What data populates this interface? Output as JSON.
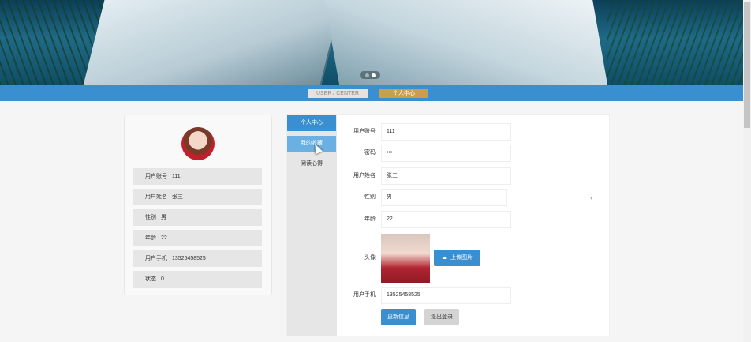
{
  "topbar": {
    "en_label": "USER / CENTER",
    "zh_label": "个人中心"
  },
  "profile_card": {
    "rows": [
      {
        "label": "用户账号",
        "value": "111"
      },
      {
        "label": "用户姓名",
        "value": "张三"
      },
      {
        "label": "性别",
        "value": "男"
      },
      {
        "label": "年龄",
        "value": "22"
      },
      {
        "label": "用户手机",
        "value": "13525458525"
      },
      {
        "label": "状态",
        "value": "0"
      }
    ]
  },
  "side_menu": {
    "items": [
      "个人中心",
      "我的收藏",
      "阅读心得"
    ]
  },
  "form": {
    "account": {
      "label": "用户账号",
      "value": "111"
    },
    "password": {
      "label": "密码",
      "value": "•••"
    },
    "name": {
      "label": "用户姓名",
      "value": "张三"
    },
    "gender": {
      "label": "性别",
      "value": "男"
    },
    "age": {
      "label": "年龄",
      "value": "22"
    },
    "avatar": {
      "label": "头像",
      "upload_label": "上传图片"
    },
    "phone": {
      "label": "用户手机",
      "value": "13525458525"
    },
    "update_label": "更新信息",
    "logout_label": "退出登录"
  },
  "colors": {
    "accent": "#3a8fd0",
    "gold": "#c9a04a"
  }
}
